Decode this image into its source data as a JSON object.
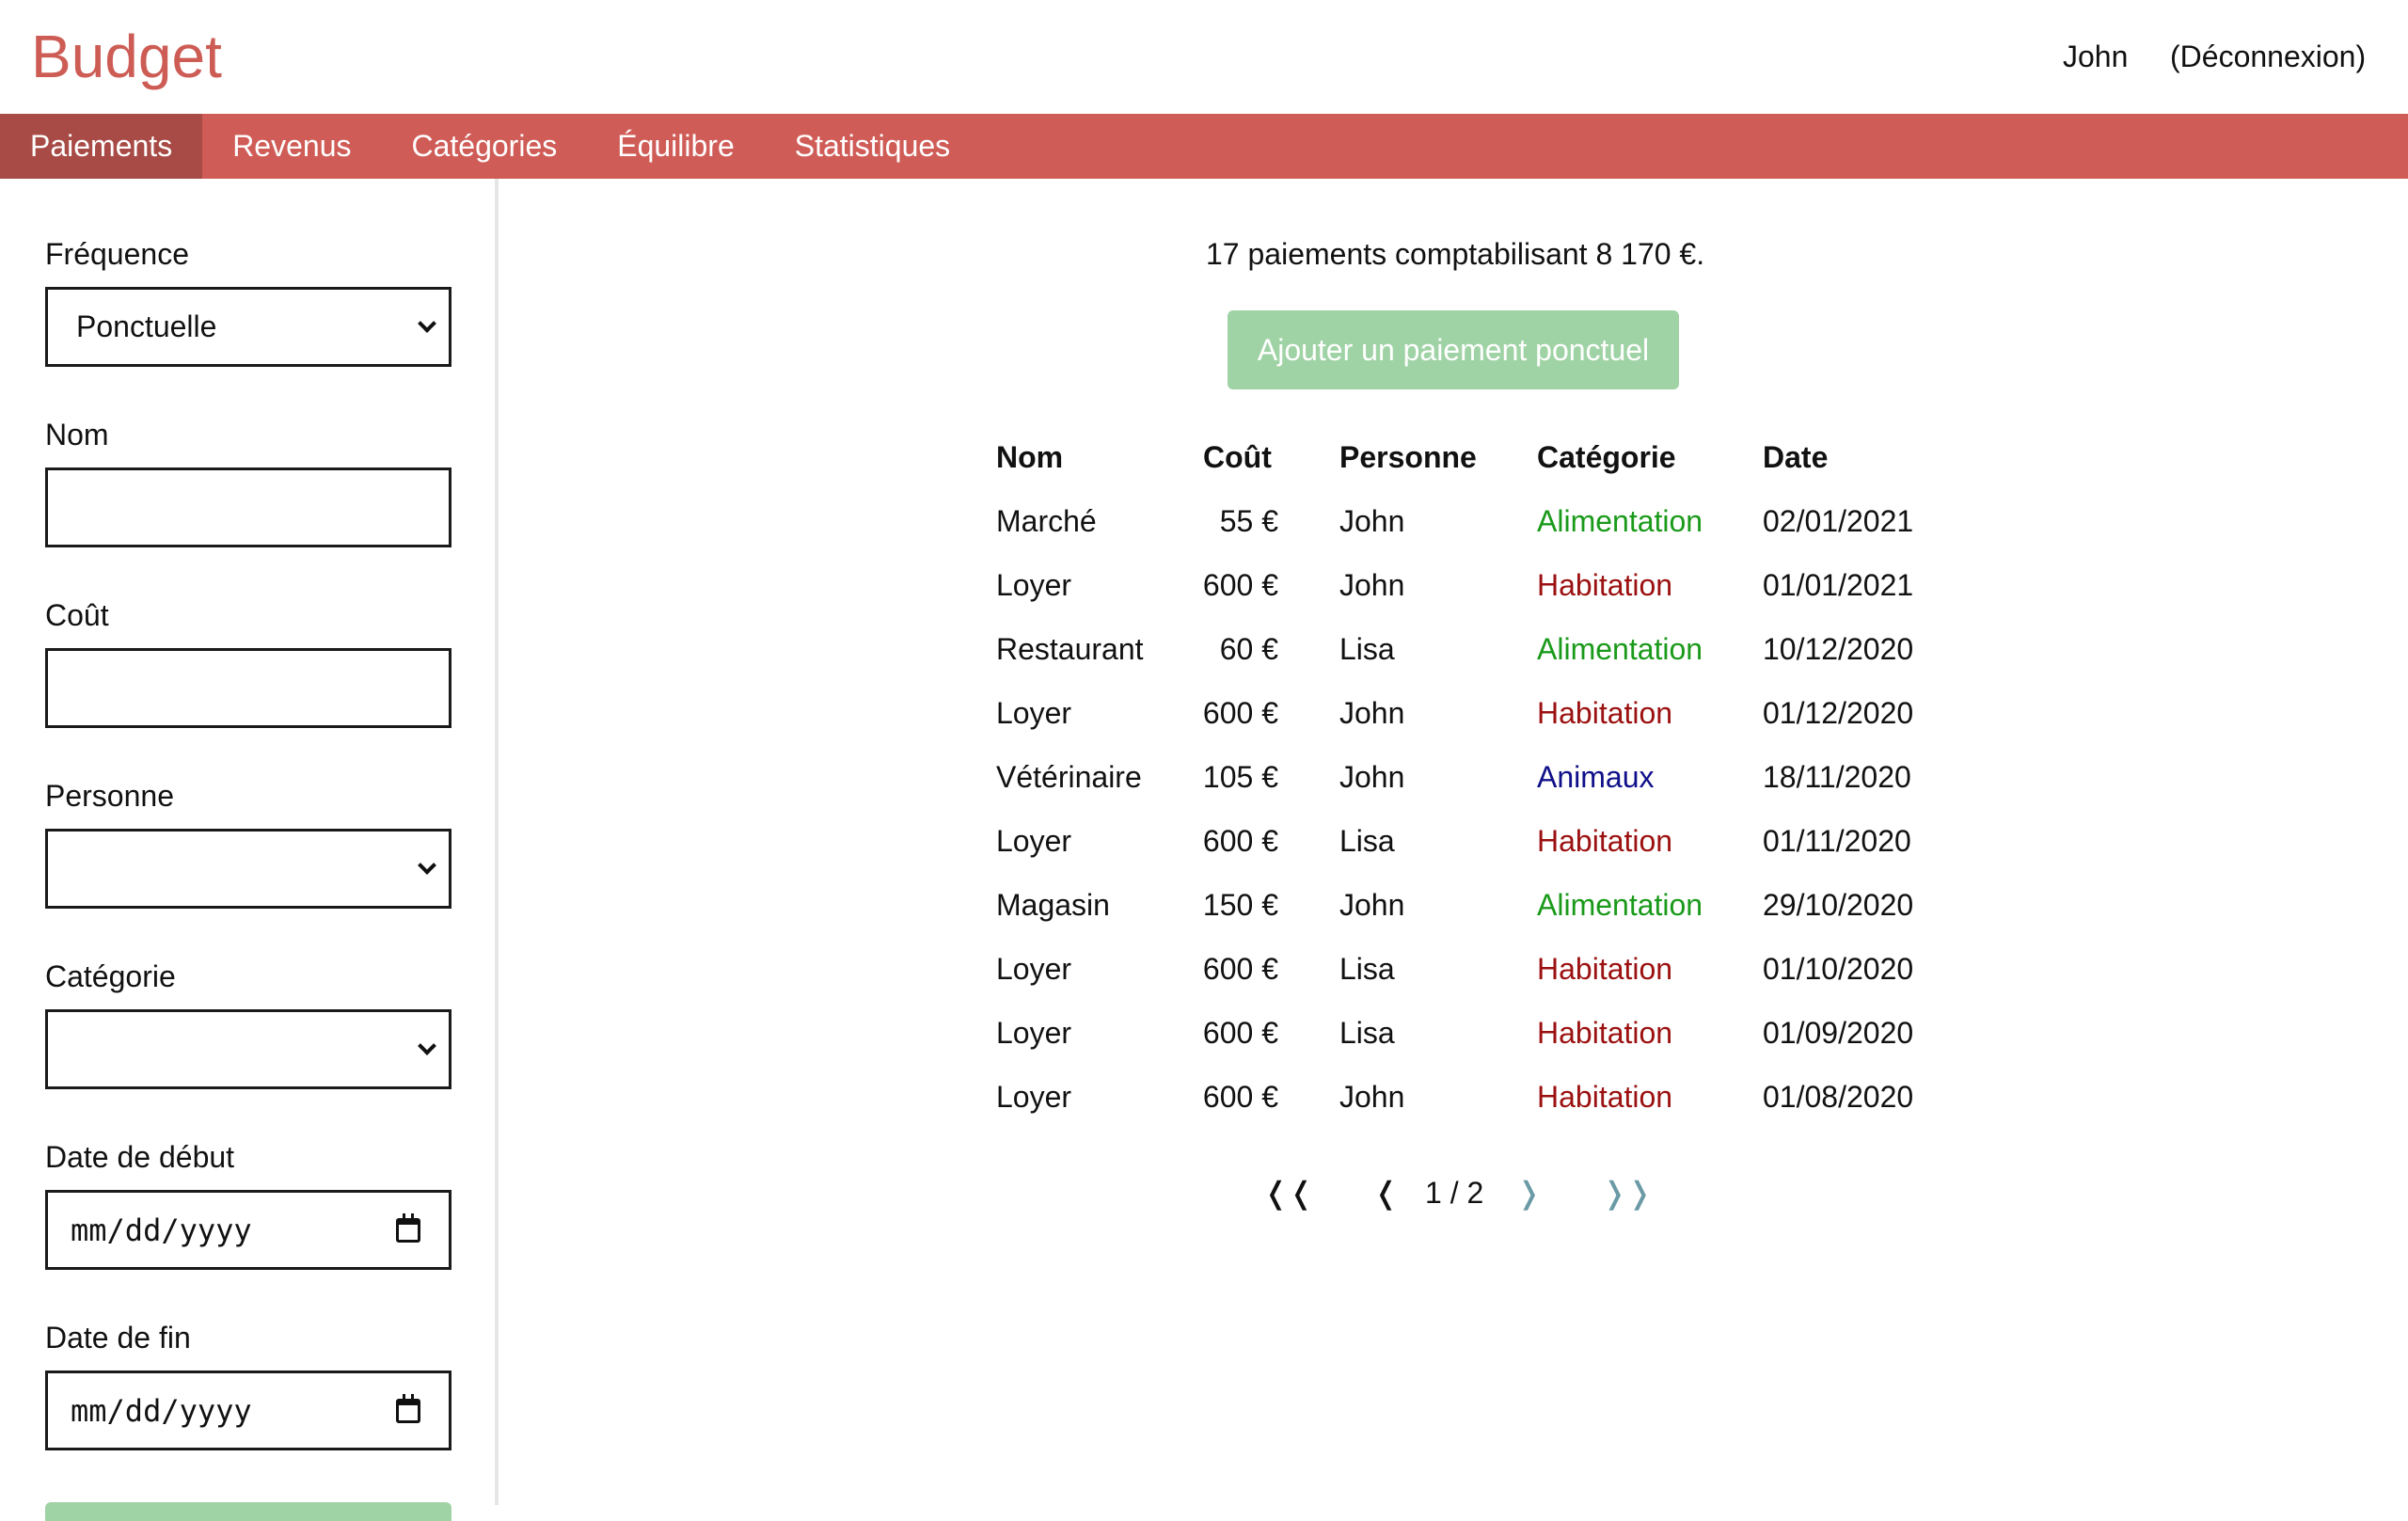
{
  "header": {
    "brand": "Budget",
    "user": "John",
    "logout": "(Déconnexion)"
  },
  "nav": {
    "items": [
      "Paiements",
      "Revenus",
      "Catégories",
      "Équilibre",
      "Statistiques"
    ],
    "active": "Paiements"
  },
  "form": {
    "frequence_label": "Fréquence",
    "frequence_value": "Ponctuelle",
    "nom_label": "Nom",
    "nom_value": "",
    "cout_label": "Coût",
    "cout_value": "",
    "personne_label": "Personne",
    "personne_value": "",
    "categorie_label": "Catégorie",
    "categorie_value": "",
    "date_debut_label": "Date de début",
    "date_debut_placeholder": "mm/dd/yyyy",
    "date_fin_label": "Date de fin",
    "date_fin_placeholder": "mm/dd/yyyy"
  },
  "main": {
    "summary": "17 paiements comptabilisant 8 170 €.",
    "add_button": "Ajouter un paiement ponctuel",
    "table": {
      "headers": [
        "Nom",
        "Coût",
        "Personne",
        "Catégorie",
        "Date"
      ],
      "rows": [
        {
          "nom": "Marché",
          "cout": "55 €",
          "personne": "John",
          "categorie": "Alimentation",
          "date": "02/01/2021"
        },
        {
          "nom": "Loyer",
          "cout": "600 €",
          "personne": "John",
          "categorie": "Habitation",
          "date": "01/01/2021"
        },
        {
          "nom": "Restaurant",
          "cout": "60 €",
          "personne": "Lisa",
          "categorie": "Alimentation",
          "date": "10/12/2020"
        },
        {
          "nom": "Loyer",
          "cout": "600 €",
          "personne": "John",
          "categorie": "Habitation",
          "date": "01/12/2020"
        },
        {
          "nom": "Vétérinaire",
          "cout": "105 €",
          "personne": "John",
          "categorie": "Animaux",
          "date": "18/11/2020"
        },
        {
          "nom": "Loyer",
          "cout": "600 €",
          "personne": "Lisa",
          "categorie": "Habitation",
          "date": "01/11/2020"
        },
        {
          "nom": "Magasin",
          "cout": "150 €",
          "personne": "John",
          "categorie": "Alimentation",
          "date": "29/10/2020"
        },
        {
          "nom": "Loyer",
          "cout": "600 €",
          "personne": "Lisa",
          "categorie": "Habitation",
          "date": "01/10/2020"
        },
        {
          "nom": "Loyer",
          "cout": "600 €",
          "personne": "Lisa",
          "categorie": "Habitation",
          "date": "01/09/2020"
        },
        {
          "nom": "Loyer",
          "cout": "600 €",
          "personne": "John",
          "categorie": "Habitation",
          "date": "01/08/2020"
        }
      ]
    },
    "pagination": {
      "first": "❬❬",
      "prev": "❬",
      "current": "1 / 2",
      "next": "❭",
      "last": "❭❭"
    }
  },
  "colors": {
    "brand": "#cd5c55",
    "nav": "#d05c57",
    "nav_active": "#a84a45",
    "button": "#9fd3a5",
    "Alimentation": "#1a9a1a",
    "Habitation": "#9b1010",
    "Animaux": "#10108a",
    "pager_disabled": "#111111",
    "pager_enabled": "#6a9aa6"
  }
}
